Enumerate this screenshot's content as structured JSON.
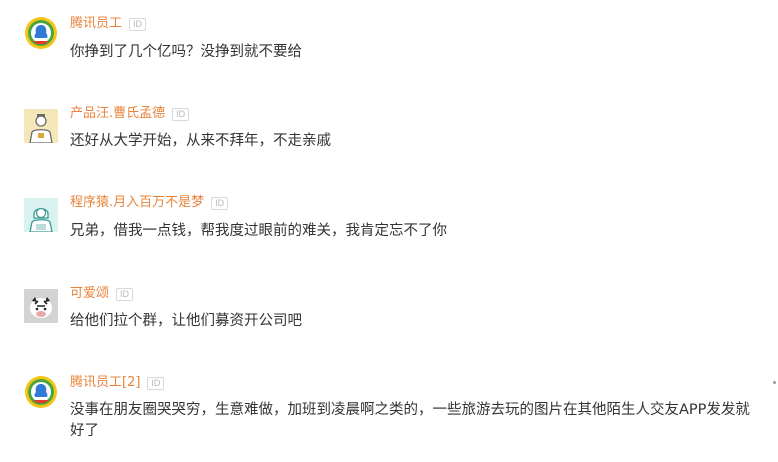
{
  "comments": [
    {
      "user": "腾讯员工",
      "badge": "ID",
      "text": "你挣到了几个亿吗？没挣到就不要给",
      "avatar": "tencent-news-icon"
    },
    {
      "user": "产品汪.曹氏孟德",
      "badge": "ID",
      "text": "还好从大学开始，从来不拜年，不走亲戚",
      "avatar": "product-manager-avatar"
    },
    {
      "user": "程序猿.月入百万不是梦",
      "badge": "ID",
      "text": "兄弟，借我一点钱，帮我度过眼前的难关，我肯定忘不了你",
      "avatar": "programmer-avatar"
    },
    {
      "user": "可爱颂",
      "badge": "ID",
      "text": "给他们拉个群，让他们募资开公司吧",
      "avatar": "zebra-avatar"
    },
    {
      "user": "腾讯员工[2]",
      "badge": "ID",
      "text": "没事在朋友圈哭哭穷，生意难做，加班到凌晨啊之类的，一些旅游去玩的图片在其他陌生人交友APP发发就好了",
      "avatar": "tencent-news-icon"
    }
  ],
  "colors": {
    "username": "#e8833a",
    "text": "#333333",
    "badge": "#b8b8b8"
  }
}
